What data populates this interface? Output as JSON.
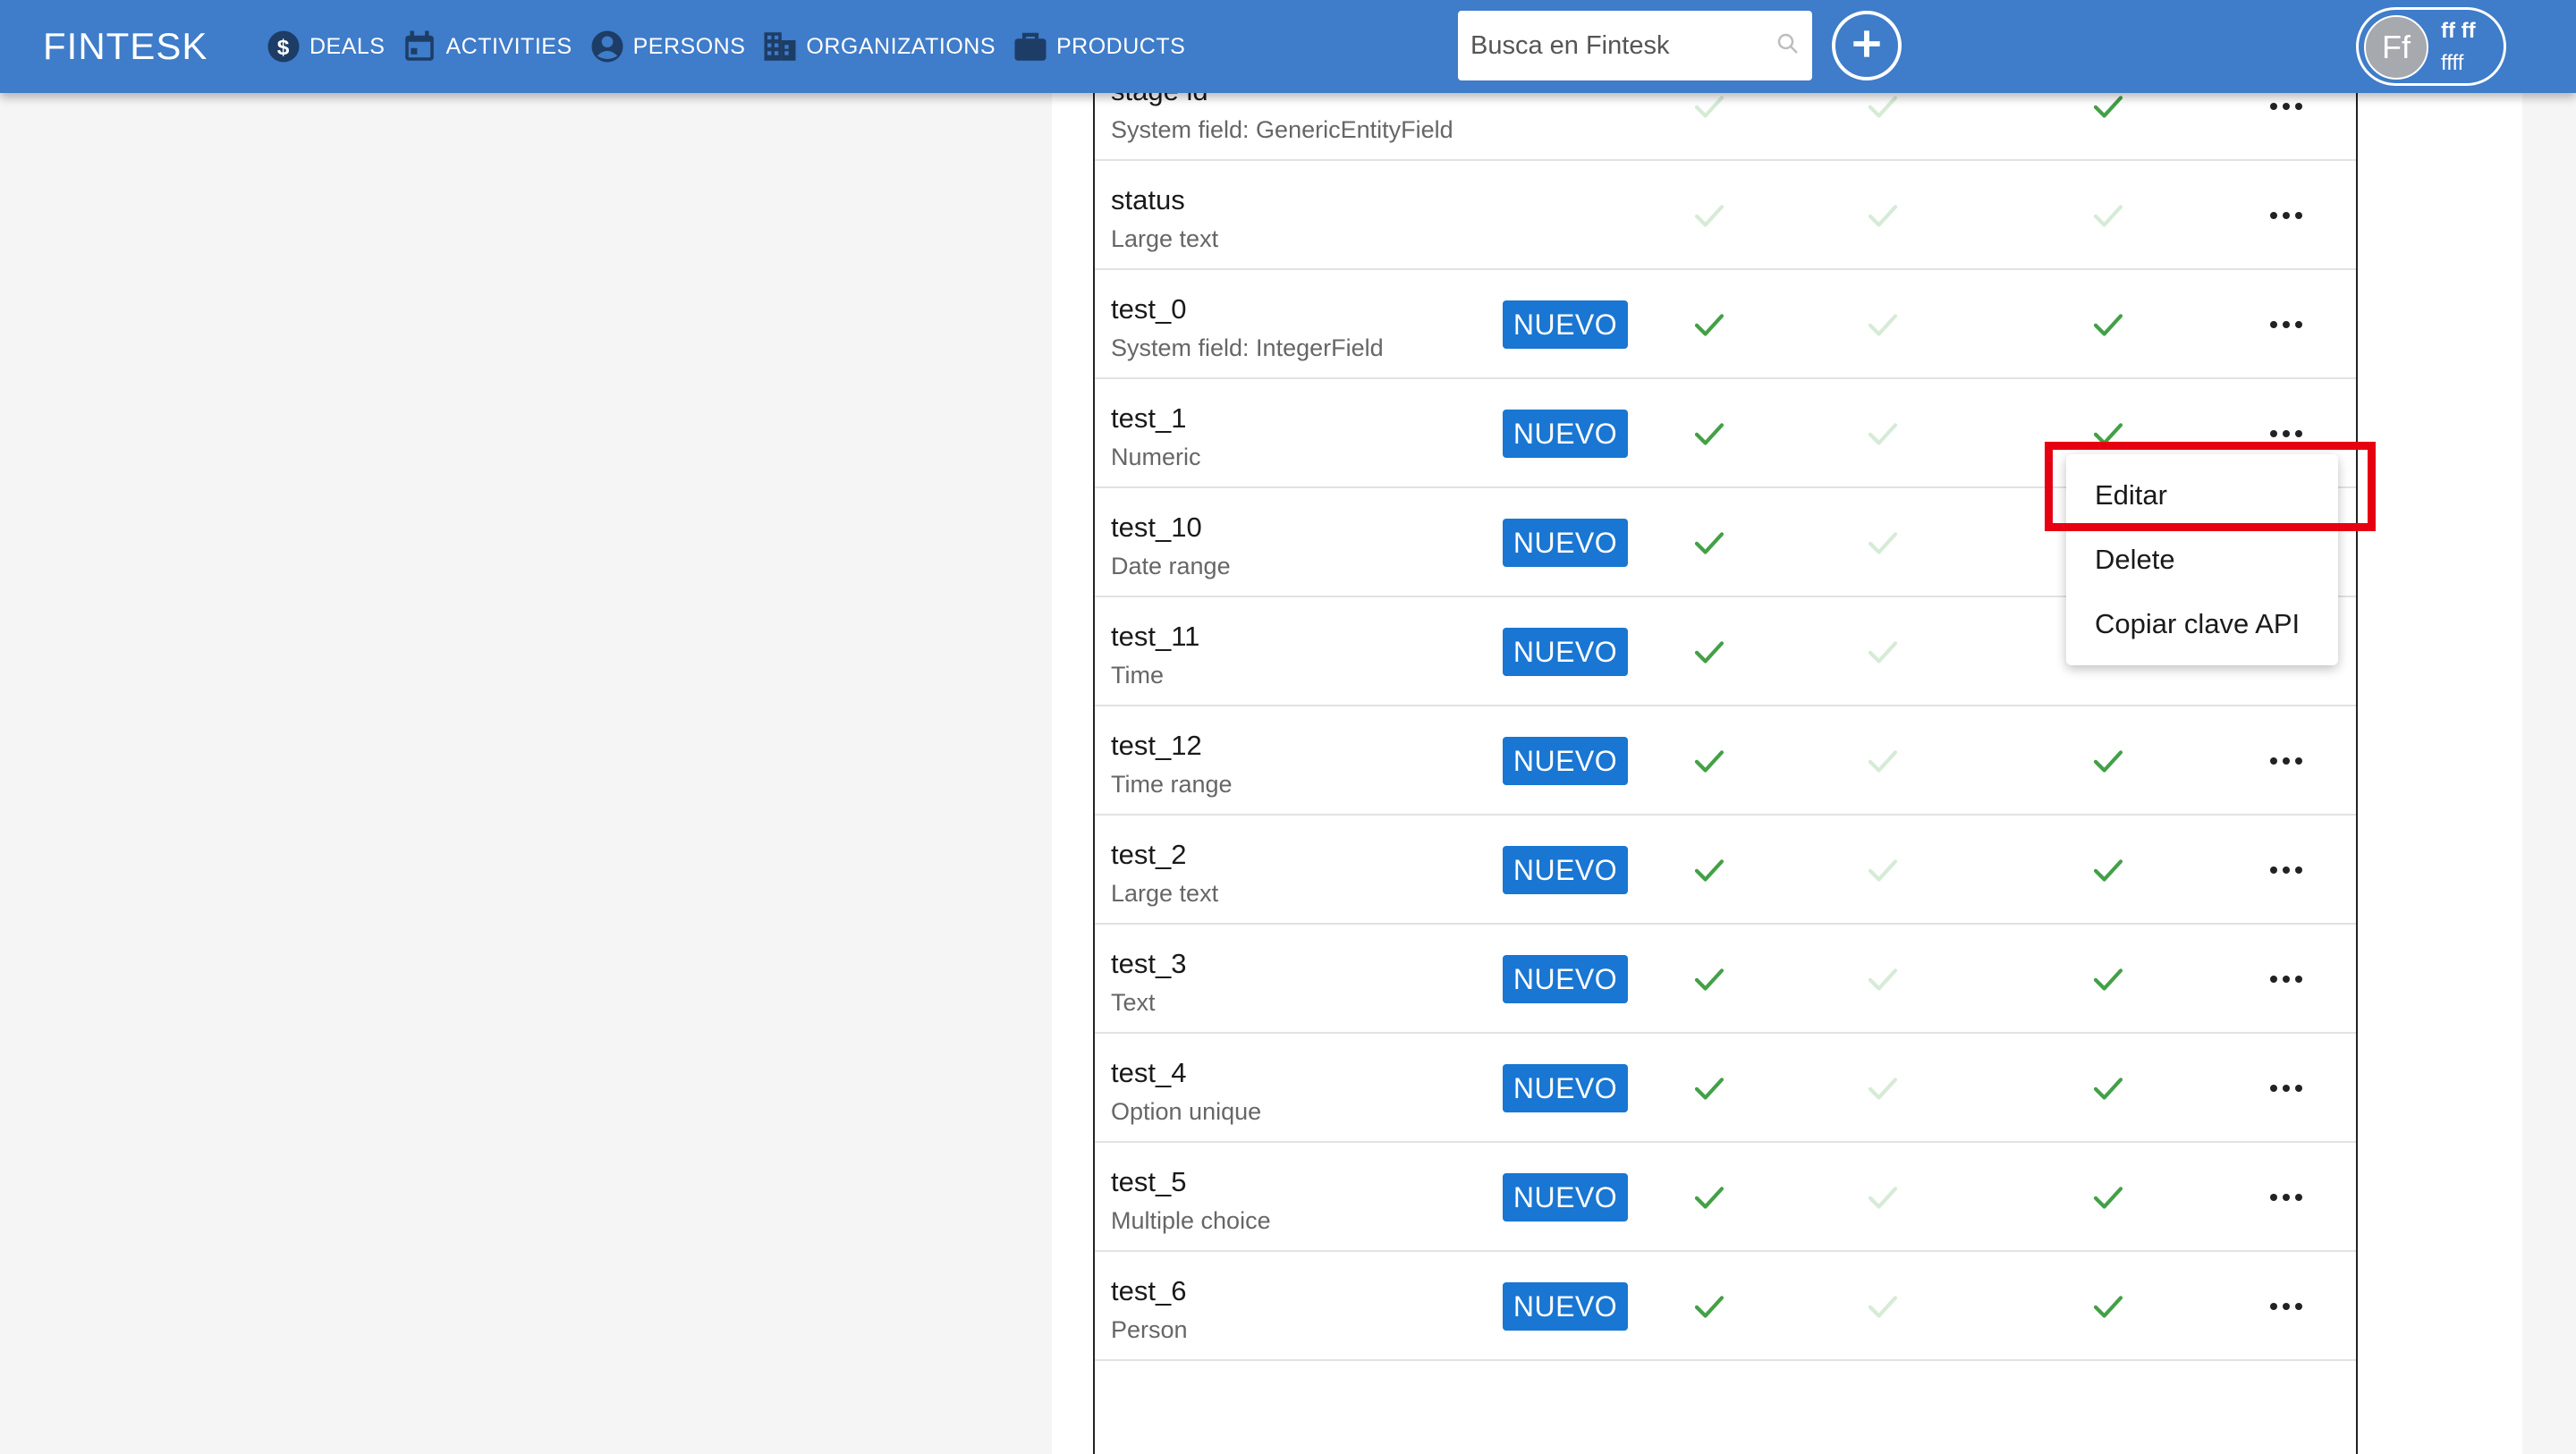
{
  "app": {
    "logo": "FINTESK"
  },
  "nav": [
    {
      "label": "DEALS",
      "icon": "dollar-circle-icon"
    },
    {
      "label": "ACTIVITIES",
      "icon": "calendar-icon"
    },
    {
      "label": "PERSONS",
      "icon": "person-circle-icon"
    },
    {
      "label": "ORGANIZATIONS",
      "icon": "building-icon"
    },
    {
      "label": "PRODUCTS",
      "icon": "briefcase-icon"
    }
  ],
  "search": {
    "placeholder": "Busca en Fintesk"
  },
  "user": {
    "initials": "Ff",
    "name": "ff ff",
    "subtitle": "ffff"
  },
  "colors": {
    "topbar": "#3f7cc9",
    "badge": "#1976d2",
    "check_active": "#43a047",
    "check_inactive": "#d6ebd6",
    "highlight": "#e60012"
  },
  "rows": [
    {
      "name": "",
      "type": "System field: GenericEntityField",
      "badge": "",
      "checks": [
        false,
        false,
        true
      ]
    },
    {
      "name": "stage id",
      "type": "System field: GenericEntityField",
      "badge": "",
      "checks": [
        false,
        false,
        true
      ]
    },
    {
      "name": "status",
      "type": "Large text",
      "badge": "",
      "checks": [
        false,
        false,
        false
      ]
    },
    {
      "name": "test_0",
      "type": "System field: IntegerField",
      "badge": "NUEVO",
      "checks": [
        true,
        false,
        true
      ]
    },
    {
      "name": "test_1",
      "type": "Numeric",
      "badge": "NUEVO",
      "checks": [
        true,
        false,
        true
      ]
    },
    {
      "name": "test_10",
      "type": "Date range",
      "badge": "NUEVO",
      "checks": [
        true,
        false,
        true
      ]
    },
    {
      "name": "test_11",
      "type": "Time",
      "badge": "NUEVO",
      "checks": [
        true,
        false,
        true
      ]
    },
    {
      "name": "test_12",
      "type": "Time range",
      "badge": "NUEVO",
      "checks": [
        true,
        false,
        true
      ]
    },
    {
      "name": "test_2",
      "type": "Large text",
      "badge": "NUEVO",
      "checks": [
        true,
        false,
        true
      ]
    },
    {
      "name": "test_3",
      "type": "Text",
      "badge": "NUEVO",
      "checks": [
        true,
        false,
        true
      ]
    },
    {
      "name": "test_4",
      "type": "Option unique",
      "badge": "NUEVO",
      "checks": [
        true,
        false,
        true
      ]
    },
    {
      "name": "test_5",
      "type": "Multiple choice",
      "badge": "NUEVO",
      "checks": [
        true,
        false,
        true
      ]
    },
    {
      "name": "test_6",
      "type": "Person",
      "badge": "NUEVO",
      "checks": [
        true,
        false,
        true
      ]
    }
  ],
  "menu": {
    "items": [
      "Editar",
      "Delete",
      "Copiar clave API"
    ],
    "highlighted": "Editar"
  }
}
